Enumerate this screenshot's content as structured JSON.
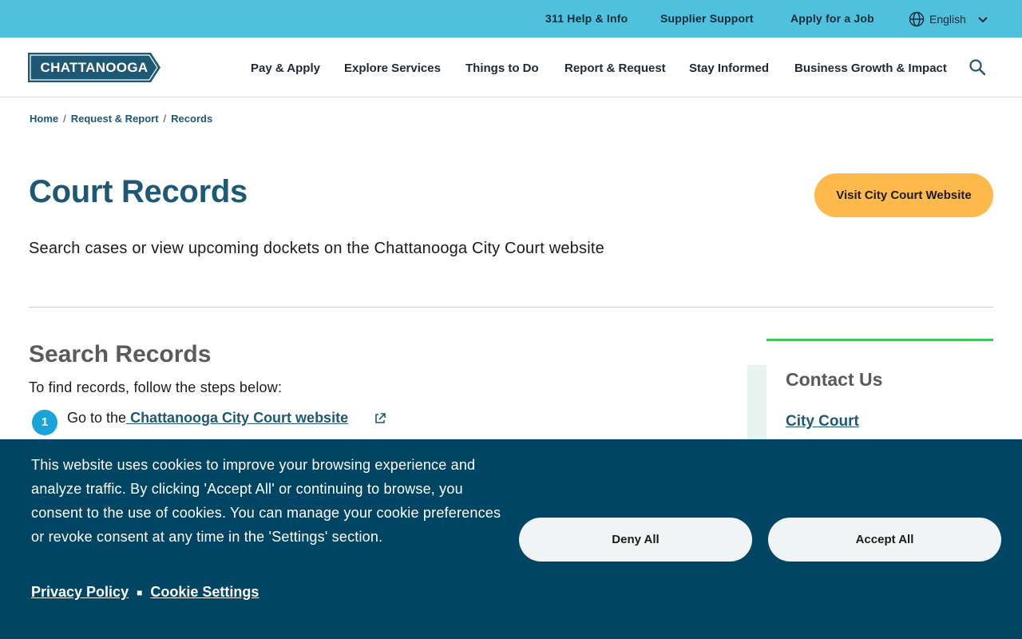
{
  "utility_bar": {
    "links": [
      "311 Help & Info",
      "Supplier Support",
      "Apply for a Job"
    ],
    "language": "English"
  },
  "header": {
    "logo_text": "CHATTANOOGA",
    "nav": [
      "Pay & Apply",
      "Explore Services",
      "Things to Do",
      "Report & Request",
      "Stay Informed",
      "Business Growth & Impact"
    ]
  },
  "breadcrumb": [
    "Home",
    "Request & Report",
    "Records"
  ],
  "hero": {
    "title": "Court Records",
    "cta_label": "Visit City Court Website",
    "subtitle": "Search cases or view upcoming dockets on the Chattanooga City Court website"
  },
  "main": {
    "section_title": "Search Records",
    "intro": "To find records, follow the steps below:",
    "steps": [
      {
        "number": "1",
        "prefix": "Go to the",
        "link": " Chattanooga City Court website"
      }
    ]
  },
  "sidebar": {
    "title": "Contact Us",
    "link": "City Court"
  },
  "cookie_banner": {
    "text": "This website uses cookies to improve your browsing experience and analyze traffic. By clicking 'Accept All' or continuing to browse, you consent to the use of cookies. You can manage your cookie preferences or revoke consent at any time in the 'Settings' section.",
    "privacy_label": "Privacy Policy",
    "settings_label": "Cookie Settings",
    "deny_label": "Deny All",
    "accept_label": "Accept All"
  },
  "colors": {
    "utility_bar": "#4fc1dd",
    "brand_teal": "#1e5875",
    "cta": "#fdb94a",
    "cookie_bg": "#004563",
    "accent_green": "#3ec65a"
  },
  "icons": [
    "globe-icon",
    "chevron-down-icon",
    "search-icon",
    "external-link-icon"
  ]
}
